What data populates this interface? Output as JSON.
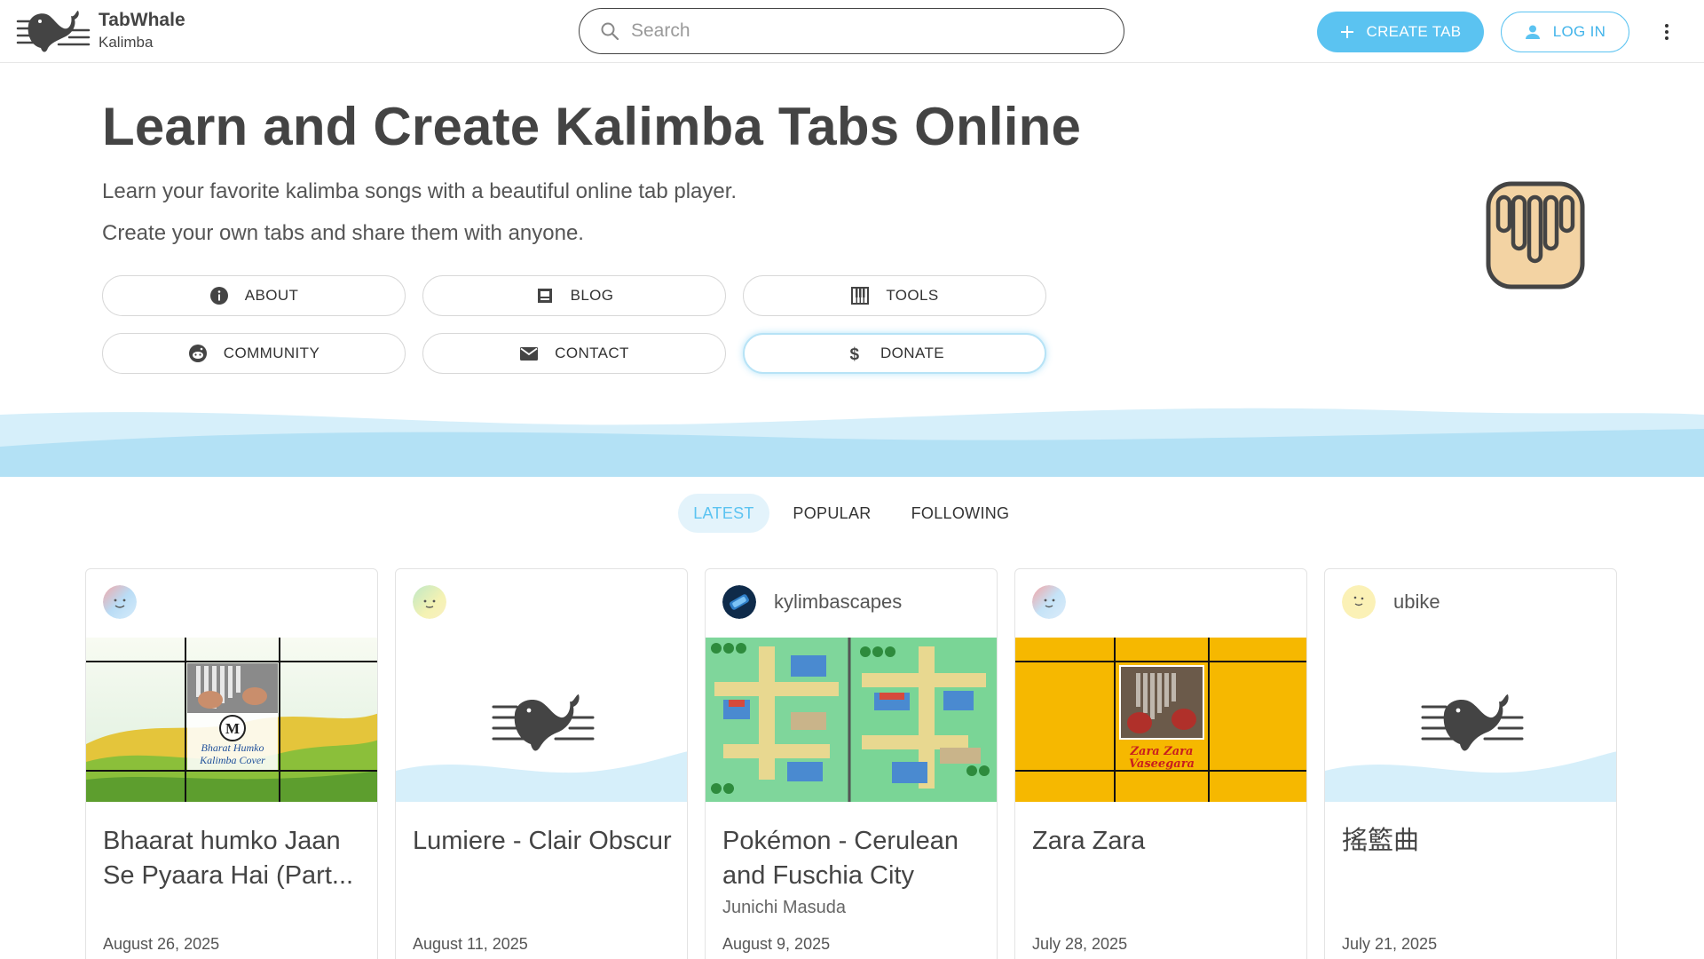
{
  "header": {
    "brand_name": "TabWhale",
    "brand_sub": "Kalimba",
    "search_placeholder": "Search",
    "create_label": "CREATE TAB",
    "login_label": "LOG IN",
    "icons": [
      "whale-logo-icon",
      "search-icon",
      "plus-icon",
      "person-icon",
      "more-vertical-icon"
    ]
  },
  "hero": {
    "title": "Learn and Create Kalimba Tabs Online",
    "line1": "Learn your favorite kalimba songs with a beautiful online tab player.",
    "line2": "Create your own tabs and share them with anyone.",
    "buttons": [
      {
        "label": "ABOUT",
        "icon": "info-icon"
      },
      {
        "label": "BLOG",
        "icon": "blog-icon"
      },
      {
        "label": "TOOLS",
        "icon": "piano-icon"
      },
      {
        "label": "COMMUNITY",
        "icon": "reddit-icon"
      },
      {
        "label": "CONTACT",
        "icon": "mail-icon"
      },
      {
        "label": "DONATE",
        "icon": "dollar-icon"
      }
    ]
  },
  "tabs": [
    "LATEST",
    "POPULAR",
    "FOLLOWING"
  ],
  "active_tab": "LATEST",
  "cards": [
    {
      "user": "",
      "title": "Bhaarat humko Jaan Se Pyaara Hai (Part...",
      "artist": "",
      "date": "August 26, 2025",
      "thumb_text": [
        "M",
        "Bharat Humko",
        "Kalimba Cover"
      ]
    },
    {
      "user": "",
      "title": "Lumiere - Clair Obscur",
      "artist": "",
      "date": "August 11, 2025"
    },
    {
      "user": "kylimbascapes",
      "title": "Pokémon - Cerulean and Fuschia City",
      "artist": "Junichi Masuda",
      "date": "August 9, 2025"
    },
    {
      "user": "",
      "title": "Zara Zara",
      "artist": "",
      "date": "July 28, 2025",
      "thumb_text": [
        "Zara Zara",
        "Vaseegara"
      ]
    },
    {
      "user": "ubike",
      "title": "搖籃曲",
      "artist": "",
      "date": "July 21, 2025"
    }
  ],
  "colors": {
    "accent": "#5bc3f1",
    "text_dark": "#444444",
    "wave_light": "#d6effa",
    "wave_mid": "#b3e1f5",
    "kalimba_fill": "#f3d3a3",
    "zara_yellow": "#f6b800"
  }
}
